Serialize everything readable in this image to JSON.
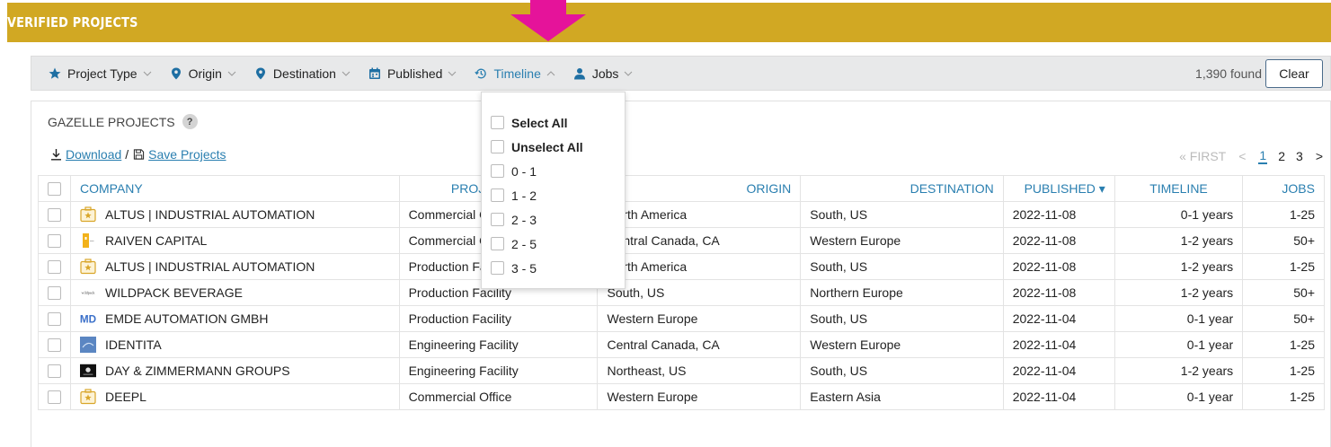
{
  "header": {
    "title": "VERIFIED PROJECTS",
    "color": "#d1a823"
  },
  "arrow_color": "#e5139a",
  "filters": [
    {
      "label": "Project Type",
      "icon": "star-icon"
    },
    {
      "label": "Origin",
      "icon": "map-pin-icon"
    },
    {
      "label": "Destination",
      "icon": "map-pin-icon"
    },
    {
      "label": "Published",
      "icon": "calendar-icon"
    },
    {
      "label": "Timeline",
      "icon": "history-icon",
      "active": true
    },
    {
      "label": "Jobs",
      "icon": "user-icon"
    }
  ],
  "found": "1,390 found",
  "clear_label": "Clear",
  "section_title": "GAZELLE PROJECTS",
  "help_label": "?",
  "actions": {
    "download": "Download",
    "separator": "/",
    "save": "Save Projects"
  },
  "pager": {
    "first": "« FIRST",
    "prev": "<",
    "pages": [
      "1",
      "2",
      "3"
    ],
    "next": ">"
  },
  "columns": {
    "company": "COMPANY",
    "project_type": "PROJECT TYPE",
    "origin": "ORIGIN",
    "destination": "DESTINATION",
    "published": "PUBLISHED ▾",
    "timeline": "TIMELINE",
    "jobs": "JOBS"
  },
  "rows": [
    {
      "company": "ALTUS | INDUSTRIAL AUTOMATION",
      "logo": "briefcase-star",
      "project_type": "Commercial Office",
      "origin": "North America",
      "destination": "South, US",
      "published": "2022-11-08",
      "timeline": "0-1 years",
      "jobs": "1-25"
    },
    {
      "company": "RAIVEN CAPITAL",
      "logo": "raiven",
      "project_type": "Commercial Office",
      "origin": "Central Canada, CA",
      "destination": "Western Europe",
      "published": "2022-11-08",
      "timeline": "1-2 years",
      "jobs": "50+"
    },
    {
      "company": "ALTUS | INDUSTRIAL AUTOMATION",
      "logo": "briefcase-star",
      "project_type": "Production Facility",
      "origin": "North America",
      "destination": "South, US",
      "published": "2022-11-08",
      "timeline": "1-2 years",
      "jobs": "1-25"
    },
    {
      "company": "WILDPACK BEVERAGE",
      "logo": "wildpack",
      "project_type": "Production Facility",
      "origin": "South, US",
      "destination": "Northern Europe",
      "published": "2022-11-08",
      "timeline": "1-2 years",
      "jobs": "50+"
    },
    {
      "company": "EMDE AUTOMATION GMBH",
      "logo": "md",
      "project_type": "Production Facility",
      "origin": "Western Europe",
      "destination": "South, US",
      "published": "2022-11-04",
      "timeline": "0-1 year",
      "jobs": "50+"
    },
    {
      "company": "IDENTITA",
      "logo": "identita",
      "project_type": "Engineering Facility",
      "origin": "Central Canada, CA",
      "destination": "Western Europe",
      "published": "2022-11-04",
      "timeline": "0-1 year",
      "jobs": "1-25"
    },
    {
      "company": "DAY & ZIMMERMANN GROUPS",
      "logo": "dayzim",
      "project_type": "Engineering Facility",
      "origin": "Northeast, US",
      "destination": "South, US",
      "published": "2022-11-04",
      "timeline": "1-2 years",
      "jobs": "1-25"
    },
    {
      "company": "DEEPL",
      "logo": "briefcase-star",
      "project_type": "Commercial Office",
      "origin": "Western Europe",
      "destination": "Eastern Asia",
      "published": "2022-11-04",
      "timeline": "0-1 year",
      "jobs": "1-25"
    }
  ],
  "dropdown": {
    "select_all": "Select All",
    "unselect_all": "Unselect All",
    "options": [
      "0 - 1",
      "1 - 2",
      "2 - 3",
      "2 - 5",
      "3 - 5"
    ]
  },
  "logo_texts": {
    "wildpack": "wildpack",
    "md": "MD"
  }
}
